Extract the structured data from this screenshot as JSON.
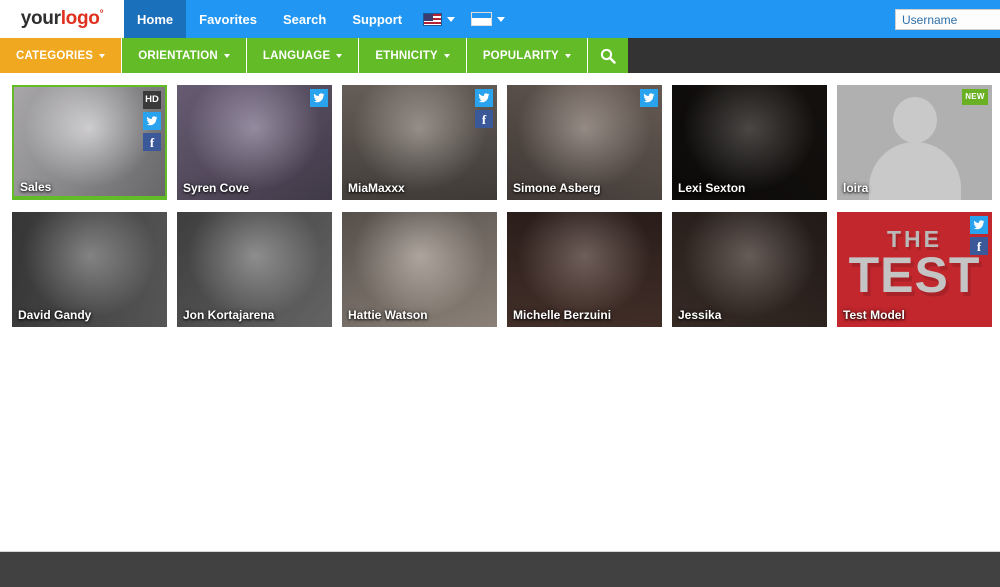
{
  "header": {
    "logo": {
      "part1": "your",
      "part2": "logo",
      "mark": "°"
    },
    "nav": [
      {
        "label": "Home",
        "active": true
      },
      {
        "label": "Favorites",
        "active": false
      },
      {
        "label": "Search",
        "active": false
      },
      {
        "label": "Support",
        "active": false
      }
    ],
    "language_selector": {
      "icon": "us-flag-icon"
    },
    "payment_selector": {
      "icon": "credit-card-icon"
    },
    "username": {
      "placeholder": "Username",
      "value": ""
    }
  },
  "categorybar": {
    "items": [
      {
        "label": "CATEGORIES",
        "highlight": true
      },
      {
        "label": "ORIENTATION",
        "highlight": false
      },
      {
        "label": "LANGUAGE",
        "highlight": false
      },
      {
        "label": "ETHNICITY",
        "highlight": false
      },
      {
        "label": "POPULARITY",
        "highlight": false
      }
    ],
    "search_icon": "search-icon"
  },
  "colors": {
    "topbar_blue": "#2196f3",
    "active_nav_blue": "#1a70ba",
    "category_green": "#63bb28",
    "category_orange": "#efa81f",
    "dark_bar": "#333333",
    "footer_gray": "#414141",
    "twitter_blue": "#2aa3ef",
    "facebook_blue": "#3b5998",
    "hd_badge_gray": "#3a3a3a",
    "new_badge_green": "#6ab023",
    "test_card_red": "#c1272d"
  },
  "grid": {
    "rows": [
      [
        {
          "name": "Sales",
          "featured": true,
          "badges": [
            "HD",
            "twitter",
            "facebook"
          ],
          "type": "photo",
          "tone": "#e8e6ea"
        },
        {
          "name": "Syren Cove",
          "featured": false,
          "badges": [
            "twitter"
          ],
          "type": "photo",
          "tone": "#8e7f9e"
        },
        {
          "name": "MiaMaxxx",
          "featured": false,
          "badges": [
            "twitter",
            "facebook"
          ],
          "type": "photo",
          "tone": "#8c8279"
        },
        {
          "name": "Simone Asberg",
          "featured": false,
          "badges": [
            "twitter"
          ],
          "type": "photo",
          "tone": "#8d7d74"
        },
        {
          "name": "Lexi Sexton",
          "featured": false,
          "badges": [],
          "type": "photo",
          "tone": "#1b1714"
        },
        {
          "name": "loira",
          "featured": false,
          "badges": [
            "NEW"
          ],
          "type": "placeholder",
          "tone": "#b0b0b0"
        }
      ],
      [
        {
          "name": "David Gandy",
          "featured": false,
          "badges": [],
          "type": "photo",
          "tone": "#777777"
        },
        {
          "name": "Jon Kortajarena",
          "featured": false,
          "badges": [],
          "type": "photo",
          "tone": "#8a8a8a"
        },
        {
          "name": "Hattie Watson",
          "featured": false,
          "badges": [],
          "type": "photo",
          "tone": "#c0b2a6"
        },
        {
          "name": "Michelle Berzuini",
          "featured": false,
          "badges": [],
          "type": "photo",
          "tone": "#5b4038"
        },
        {
          "name": "Jessika",
          "featured": false,
          "badges": [],
          "type": "photo",
          "tone": "#4a3a33"
        },
        {
          "name": "Test Model",
          "featured": false,
          "badges": [
            "twitter",
            "facebook"
          ],
          "type": "test",
          "tone": "#c1272d",
          "test_line1": "THE",
          "test_line2": "TEST"
        }
      ]
    ]
  },
  "footer": {
    "text": ""
  }
}
